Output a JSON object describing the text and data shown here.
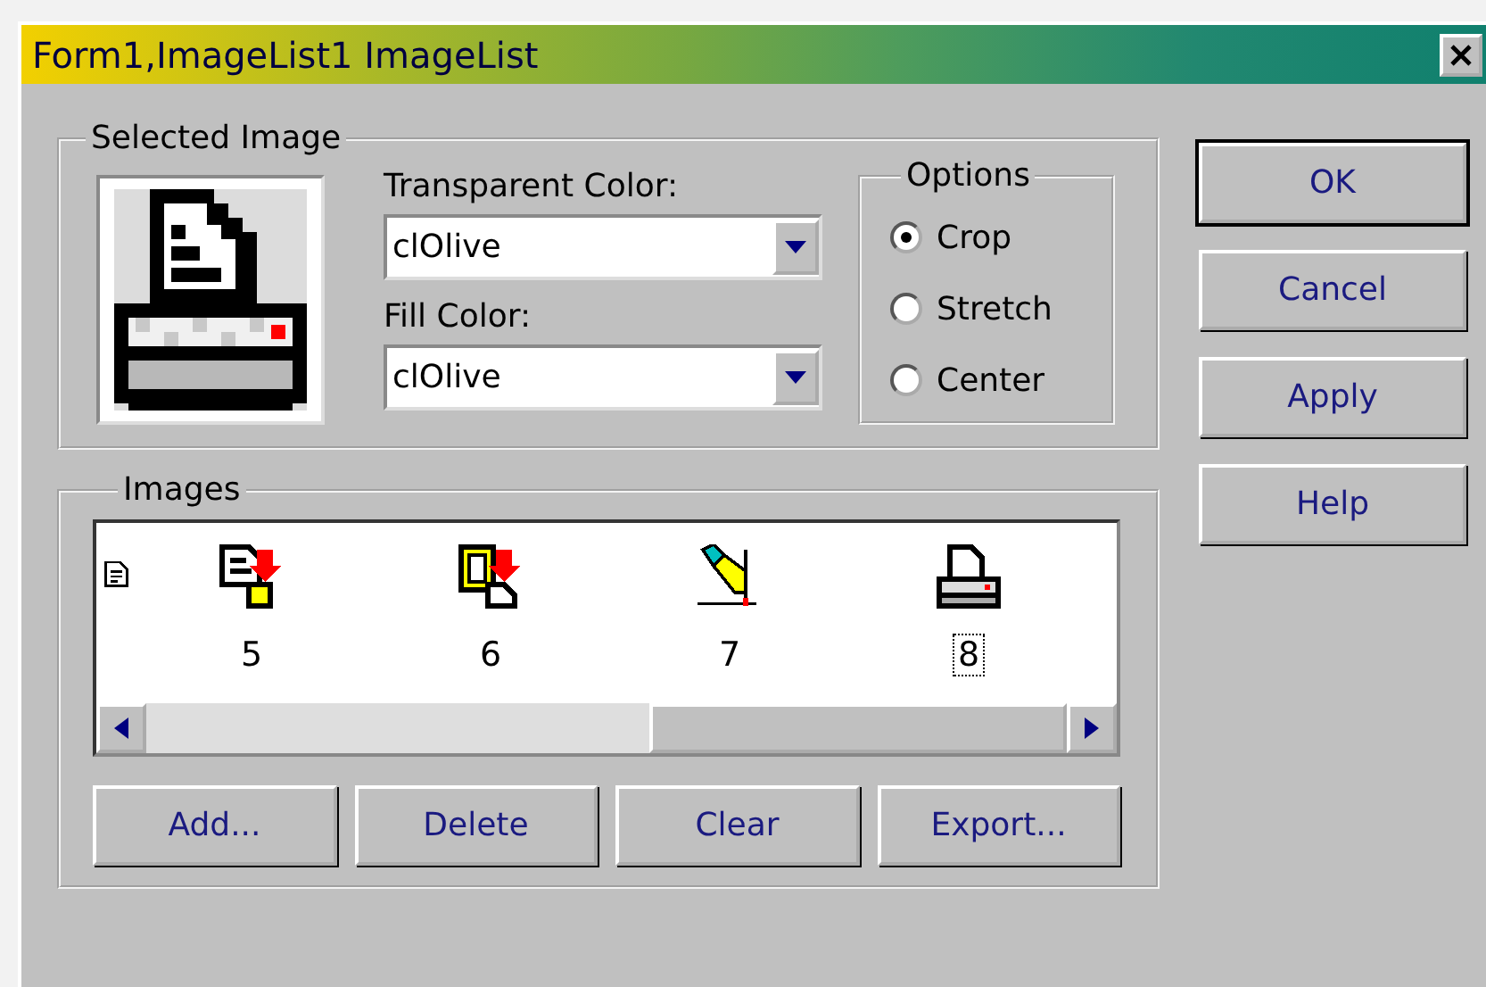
{
  "window": {
    "title": "Form1,ImageList1 ImageList"
  },
  "selected_image": {
    "legend": "Selected Image",
    "transparent_color": {
      "label": "Transparent Color:",
      "value": "clOlive"
    },
    "fill_color": {
      "label": "Fill Color:",
      "value": "clOlive"
    },
    "options": {
      "legend": "Options",
      "items": [
        {
          "label": "Crop",
          "selected": true
        },
        {
          "label": "Stretch",
          "selected": false
        },
        {
          "label": "Center",
          "selected": false
        }
      ]
    }
  },
  "images": {
    "legend": "Images",
    "items": [
      {
        "kind": "document",
        "partial": true
      },
      {
        "kind": "paste-document",
        "label": "5",
        "selected": false
      },
      {
        "kind": "paste-clipboard",
        "label": "6",
        "selected": false
      },
      {
        "kind": "hand-pen",
        "label": "7",
        "selected": false
      },
      {
        "kind": "printer",
        "label": "8",
        "selected": true
      }
    ],
    "buttons": [
      "Add...",
      "Delete",
      "Clear",
      "Export..."
    ]
  },
  "side_buttons": [
    {
      "label": "OK",
      "default": true
    },
    {
      "label": "Cancel",
      "default": false
    },
    {
      "label": "Apply",
      "default": false
    },
    {
      "label": "Help",
      "default": false
    }
  ]
}
